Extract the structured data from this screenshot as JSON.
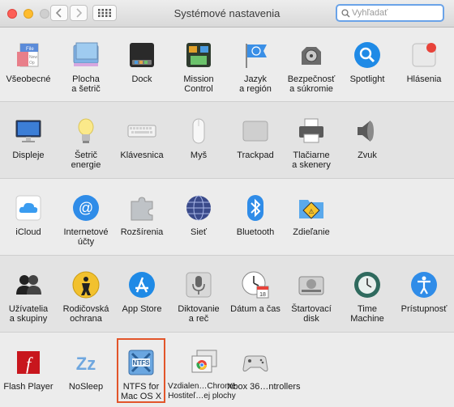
{
  "window": {
    "title": "Systémové nastavenia"
  },
  "search": {
    "placeholder": "Vyhľadať"
  },
  "rows": [
    [
      {
        "label": "Všeobecné",
        "icon": "general-icon"
      },
      {
        "label": "Plocha\na šetrič",
        "icon": "desktop-screensaver-icon"
      },
      {
        "label": "Dock",
        "icon": "dock-icon"
      },
      {
        "label": "Mission\nControl",
        "icon": "mission-control-icon"
      },
      {
        "label": "Jazyk\na región",
        "icon": "language-region-icon"
      },
      {
        "label": "Bezpečnosť\na súkromie",
        "icon": "security-privacy-icon"
      },
      {
        "label": "Spotlight",
        "icon": "spotlight-icon"
      },
      {
        "label": "Hlásenia",
        "icon": "notifications-icon"
      }
    ],
    [
      {
        "label": "Displeje",
        "icon": "displays-icon"
      },
      {
        "label": "Šetrič\nenergie",
        "icon": "energy-saver-icon"
      },
      {
        "label": "Klávesnica",
        "icon": "keyboard-icon"
      },
      {
        "label": "Myš",
        "icon": "mouse-icon"
      },
      {
        "label": "Trackpad",
        "icon": "trackpad-icon"
      },
      {
        "label": "Tlačiarne\na skenery",
        "icon": "printers-scanners-icon"
      },
      {
        "label": "Zvuk",
        "icon": "sound-icon"
      }
    ],
    [
      {
        "label": "iCloud",
        "icon": "icloud-icon"
      },
      {
        "label": "Internetové\núčty",
        "icon": "internet-accounts-icon"
      },
      {
        "label": "Rozšírenia",
        "icon": "extensions-icon"
      },
      {
        "label": "Sieť",
        "icon": "network-icon"
      },
      {
        "label": "Bluetooth",
        "icon": "bluetooth-icon"
      },
      {
        "label": "Zdieľanie",
        "icon": "sharing-icon"
      }
    ],
    [
      {
        "label": "Užívatelia\na skupiny",
        "icon": "users-groups-icon"
      },
      {
        "label": "Rodičovská\nochrana",
        "icon": "parental-controls-icon"
      },
      {
        "label": "App Store",
        "icon": "app-store-icon"
      },
      {
        "label": "Diktovanie\na reč",
        "icon": "dictation-speech-icon"
      },
      {
        "label": "Dátum a čas",
        "icon": "date-time-icon"
      },
      {
        "label": "Štartovací\ndisk",
        "icon": "startup-disk-icon"
      },
      {
        "label": "Time\nMachine",
        "icon": "time-machine-icon"
      },
      {
        "label": "Prístupnosť",
        "icon": "accessibility-icon"
      }
    ],
    [
      {
        "label": "Flash Player",
        "icon": "flash-player-icon"
      },
      {
        "label": "NoSleep",
        "icon": "nosleep-icon"
      },
      {
        "label": "NTFS for\nMac OS X",
        "icon": "ntfs-icon"
      },
      {
        "label": "Vzdialen…Chrome\nHostiteľ…ej plochy",
        "icon": "chrome-remote-desktop-icon"
      },
      {
        "label": "Xbox 36…ntrollers",
        "icon": "xbox-controller-icon"
      }
    ]
  ],
  "icons": {
    "accent": "#1f7ae0",
    "flash_text": "f",
    "ntfs_text": "NTFS",
    "zz_text": "Zz",
    "calendar_day": "18"
  }
}
